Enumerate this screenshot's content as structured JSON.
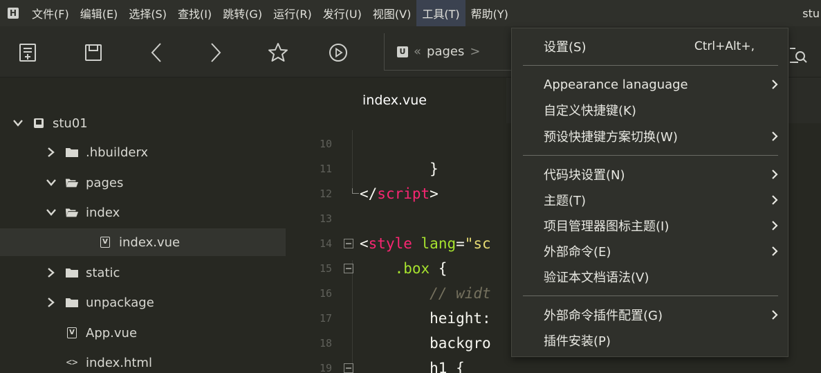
{
  "menubar": {
    "items": [
      "文件(F)",
      "编辑(E)",
      "选择(S)",
      "查找(I)",
      "跳转(G)",
      "运行(R)",
      "发行(U)",
      "视图(V)",
      "工具(T)",
      "帮助(Y)"
    ],
    "active_index": 8,
    "right_text": "stu"
  },
  "toolbar": {
    "breadcrumb": {
      "back_glyph": "«",
      "segment": "pages",
      "sep": ">"
    }
  },
  "sidebar": {
    "tree": [
      {
        "label": "stu01",
        "icon": "project-icon",
        "chevron": "down",
        "depth": 0
      },
      {
        "label": ".hbuilderx",
        "icon": "folder-icon",
        "chevron": "right",
        "depth": 1
      },
      {
        "label": "pages",
        "icon": "folder-open-icon",
        "chevron": "down",
        "depth": 1
      },
      {
        "label": "index",
        "icon": "folder-open-icon",
        "chevron": "down",
        "depth": 2
      },
      {
        "label": "index.vue",
        "icon": "vue-file-icon",
        "chevron": "none",
        "depth": 3,
        "selected": true
      },
      {
        "label": "static",
        "icon": "folder-icon",
        "chevron": "right",
        "depth": 1
      },
      {
        "label": "unpackage",
        "icon": "folder-icon",
        "chevron": "right",
        "depth": 1
      },
      {
        "label": "App.vue",
        "icon": "vue-file-icon",
        "chevron": "none",
        "depth": 1
      },
      {
        "label": "index.html",
        "icon": "html-file-icon",
        "chevron": "none",
        "depth": 1
      }
    ]
  },
  "editor": {
    "tab_label": "index.vue",
    "lines": [
      {
        "num": "10",
        "fold": false,
        "tokens": []
      },
      {
        "num": "11",
        "fold": false,
        "tokens": [
          {
            "t": "        }",
            "c": "c-white"
          }
        ]
      },
      {
        "num": "12",
        "fold": false,
        "tokens": [
          {
            "t": "</",
            "c": "c-white"
          },
          {
            "t": "script",
            "c": "c-pink"
          },
          {
            "t": ">",
            "c": "c-white"
          }
        ]
      },
      {
        "num": "13",
        "fold": false,
        "tokens": []
      },
      {
        "num": "14",
        "fold": true,
        "tokens": [
          {
            "t": "<",
            "c": "c-white"
          },
          {
            "t": "style",
            "c": "c-pink"
          },
          {
            "t": " ",
            "c": "c-white"
          },
          {
            "t": "lang",
            "c": "c-green"
          },
          {
            "t": "=",
            "c": "c-white"
          },
          {
            "t": "\"sc",
            "c": "c-yellow"
          }
        ]
      },
      {
        "num": "15",
        "fold": true,
        "tokens": [
          {
            "t": "    ",
            "c": "c-white"
          },
          {
            "t": ".box",
            "c": "c-green"
          },
          {
            "t": " {",
            "c": "c-white"
          }
        ]
      },
      {
        "num": "16",
        "fold": false,
        "tokens": [
          {
            "t": "        ",
            "c": "c-white"
          },
          {
            "t": "// widt",
            "c": "c-gray"
          }
        ]
      },
      {
        "num": "17",
        "fold": false,
        "tokens": [
          {
            "t": "        height:",
            "c": "c-white"
          }
        ]
      },
      {
        "num": "18",
        "fold": false,
        "tokens": [
          {
            "t": "        backgro",
            "c": "c-white"
          }
        ]
      },
      {
        "num": "19",
        "fold": true,
        "tokens": [
          {
            "t": "        h1 {",
            "c": "c-white"
          }
        ]
      }
    ]
  },
  "dropdown": {
    "items": [
      {
        "label": "设置(S)",
        "shortcut": "Ctrl+Alt+,",
        "submenu": false,
        "highlight": true
      },
      {
        "label": "Appearance lanaguage",
        "shortcut": "",
        "submenu": true
      },
      {
        "label": "自定义快捷键(K)",
        "shortcut": "",
        "submenu": false
      },
      {
        "label": "预设快捷键方案切换(W)",
        "shortcut": "",
        "submenu": true
      },
      {
        "label": "代码块设置(N)",
        "shortcut": "",
        "submenu": true
      },
      {
        "label": "主题(T)",
        "shortcut": "",
        "submenu": true
      },
      {
        "label": "项目管理器图标主题(I)",
        "shortcut": "",
        "submenu": true
      },
      {
        "label": "外部命令(E)",
        "shortcut": "",
        "submenu": true
      },
      {
        "label": "验证本文档语法(V)",
        "shortcut": "",
        "submenu": false
      },
      {
        "label": "外部命令插件配置(G)",
        "shortcut": "",
        "submenu": true
      },
      {
        "label": "插件安装(P)",
        "shortcut": "",
        "submenu": false
      }
    ]
  },
  "colors": {
    "menubar_bg": "#2f302b",
    "active_menu_bg": "#3b4250",
    "editor_bg": "#272822",
    "selected_row_bg": "#33342f"
  }
}
